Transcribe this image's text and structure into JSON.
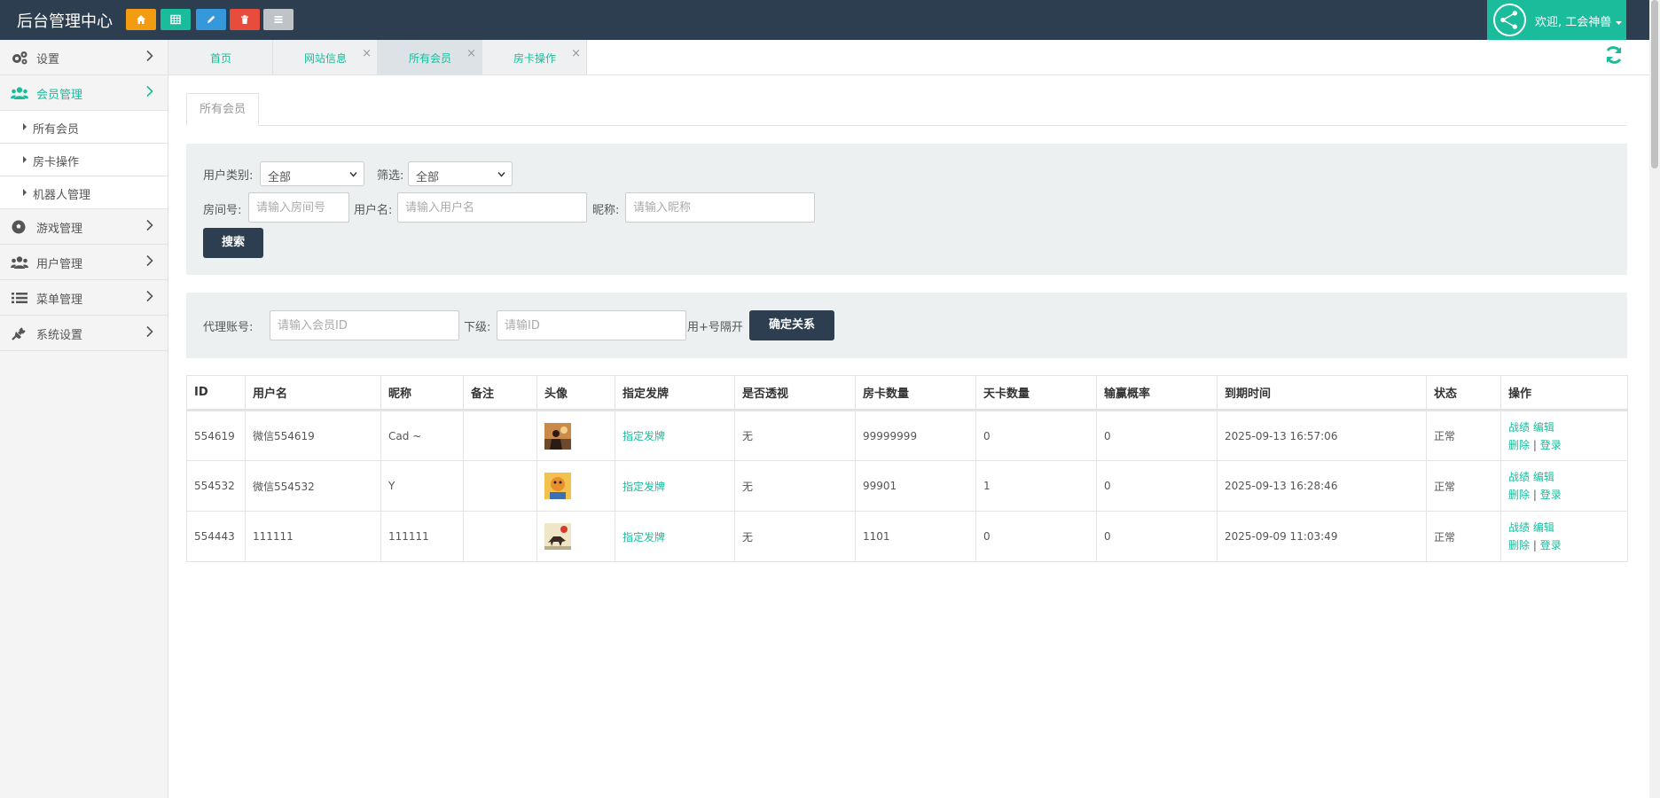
{
  "header": {
    "brand": "后台管理中心",
    "quick_buttons": [
      {
        "icon": "home-icon",
        "color": "#f39c12"
      },
      {
        "icon": "grid-icon",
        "color": "#1abc9c"
      },
      {
        "icon": "pencil-icon",
        "color": "#3498db"
      },
      {
        "icon": "trash-icon",
        "color": "#e74c3c"
      },
      {
        "icon": "list-icon",
        "color": "#bdc3c7"
      }
    ],
    "user_greeting": "欢迎, 工会神兽"
  },
  "sidebar": {
    "items": [
      {
        "label": "设置",
        "icon": "gears-icon"
      },
      {
        "label": "会员管理",
        "icon": "users-icon",
        "active": true
      },
      {
        "label": "游戏管理",
        "icon": "soccer-ball-icon"
      },
      {
        "label": "用户管理",
        "icon": "users-icon"
      },
      {
        "label": "菜单管理",
        "icon": "list-icon"
      },
      {
        "label": "系统设置",
        "icon": "plug-icon"
      }
    ],
    "sub_items": [
      {
        "label": "所有会员"
      },
      {
        "label": "房卡操作"
      },
      {
        "label": "机器人管理"
      }
    ]
  },
  "tabs": [
    {
      "label": "首页",
      "closable": false
    },
    {
      "label": "网站信息",
      "closable": true
    },
    {
      "label": "所有会员",
      "closable": true,
      "active": true
    },
    {
      "label": "房卡操作",
      "closable": true
    }
  ],
  "page_tab": "所有会员",
  "filter": {
    "user_type_label": "用户类别:",
    "user_type_value": "全部",
    "filter_label": "筛选:",
    "filter_value": "全部",
    "room_label": "房间号:",
    "room_placeholder": "请输入房间号",
    "username_label": "用户名:",
    "username_placeholder": "请输入用户名",
    "nickname_label": "昵称:",
    "nickname_placeholder": "请输入昵称",
    "search_button": "搜索"
  },
  "agent": {
    "agent_label": "代理账号:",
    "agent_placeholder": "请输入会员ID",
    "sub_label": "下级:",
    "sub_placeholder": "请输ID",
    "hint": "用+号隔开",
    "confirm_button": "确定关系"
  },
  "table": {
    "headers": [
      "ID",
      "用户名",
      "昵称",
      "备注",
      "头像",
      "指定发牌",
      "是否透视",
      "房卡数量",
      "天卡数量",
      "输赢概率",
      "到期时间",
      "状态",
      "操作"
    ],
    "rows": [
      {
        "id": "554619",
        "username": "微信554619",
        "nickname": "Cad ~",
        "note": "",
        "avatar": "person-photo",
        "deal": "指定发牌",
        "xray": "无",
        "cards": "99999999",
        "day_cards": "0",
        "rate": "0",
        "expire": "2025-09-13 16:57:06",
        "status": "正常"
      },
      {
        "id": "554532",
        "username": "微信554532",
        "nickname": "Y",
        "note": "",
        "avatar": "cartoon-photo",
        "deal": "指定发牌",
        "xray": "无",
        "cards": "99901",
        "day_cards": "1",
        "rate": "0",
        "expire": "2025-09-13 16:28:46",
        "status": "正常"
      },
      {
        "id": "554443",
        "username": "111111",
        "nickname": "111111",
        "note": "",
        "avatar": "horse-painting",
        "deal": "指定发牌",
        "xray": "无",
        "cards": "1101",
        "day_cards": "0",
        "rate": "0",
        "expire": "2025-09-09 11:03:49",
        "status": "正常"
      }
    ],
    "ops": {
      "record": "战绩",
      "edit": "编辑",
      "delete": "删除",
      "login": "登录",
      "separator": "|"
    }
  },
  "colors": {
    "accent": "#1abc9c",
    "header_bg": "#2c3e50",
    "panel_bg": "#ecf0f1"
  }
}
